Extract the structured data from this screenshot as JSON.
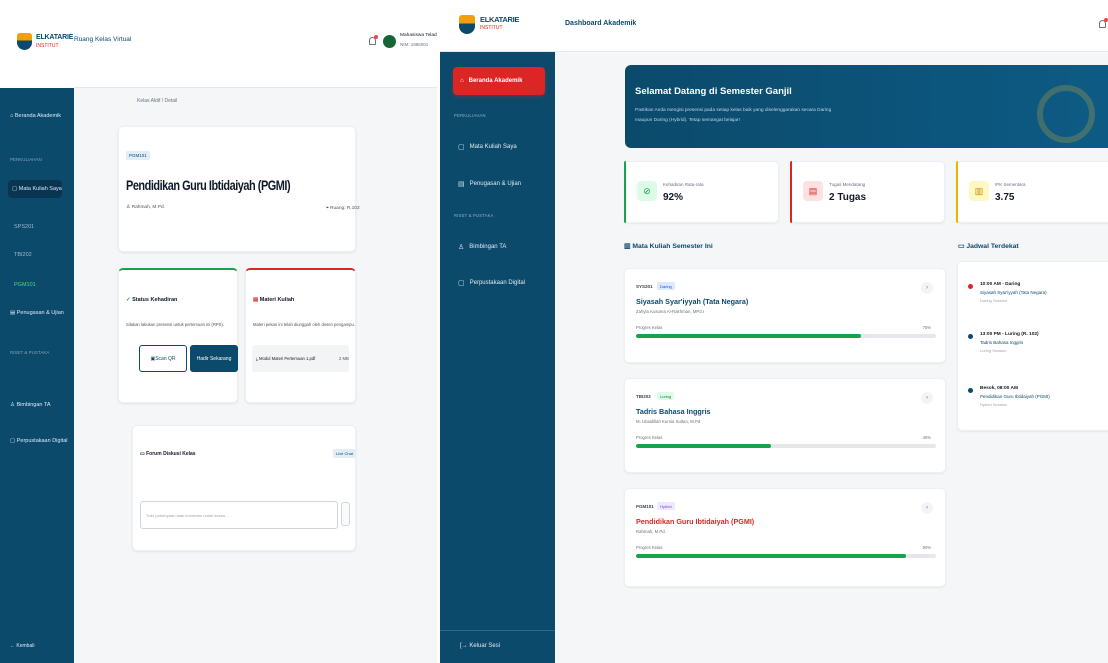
{
  "left": {
    "brand": {
      "name": "ELKATARIE",
      "sub": "INSTITUT"
    },
    "topbar_title": "Ruang Kelas Virtual",
    "user": {
      "name": "Mahasiswa Teladan",
      "id": "NIM: 1986001"
    },
    "nav": {
      "dashboard": "Beranda Akademik",
      "section1": "PERKULIAHAN",
      "courses": "Mata Kuliah Saya",
      "sub1": "SPS201",
      "sub2": "TBI202",
      "sub3": "PGM101",
      "tasks": "Penugasan & Ujian",
      "section2": "RISET & PUSTAKA",
      "thesis": "Bimbingan TA",
      "library": "Perpustakaan Digital",
      "back": "Kembali"
    },
    "breadcrumb": "Kelas Aktif / Detail",
    "course": {
      "code": "PGM101",
      "title": "Pendidikan Guru Ibtidaiyah (PGMI)",
      "lecturer": "Rahmah, M.Pd.",
      "room": "Ruang: R.102"
    },
    "attendance": {
      "title": "Status Kehadiran",
      "desc": "Silakan lakukan presensi untuk pertemuan ini (RPS).",
      "btn_scan": "Scan QR",
      "btn_present": "Hadir Sekarang"
    },
    "materials": {
      "title": "Materi Kuliah",
      "desc": "Materi pekan ini telah diunggah oleh dosen pengampu.",
      "file": "Modul Materi Pertemuan 1.pdf",
      "size": "2 MB"
    },
    "forum": {
      "title": "Forum Diskusi Kelas",
      "badge": "Live Chat",
      "placeholder": "Tulis pertanyaan atau komentar untuk dosen..."
    }
  },
  "right": {
    "brand": {
      "name": "ELKATARIE",
      "sub": "INSTITUT"
    },
    "topbar_title": "Dashboard Akademik",
    "nav": {
      "active": "Beranda Akademik",
      "section1": "PERKULIAHAN",
      "courses": "Mata Kuliah Saya",
      "tasks": "Penugasan & Ujian",
      "section2": "RISET & PUSTAKA",
      "thesis": "Bimbingan TA",
      "library": "Perpustakaan Digital",
      "logout": "Keluar Sesi"
    },
    "hero": {
      "title": "Selamat Datang di Semester Ganjil",
      "line1": "Pastikan Anda mengisi presensi pada setiap kelas baik yang diselenggarakan secara Daring",
      "line2": "maupun Daring (Hybrid). Tetap semangat belajar!"
    },
    "stats": [
      {
        "label": "Kehadiran Rata-rata",
        "value": "92%",
        "color": "#16a34a",
        "icon": "check-circle-icon"
      },
      {
        "label": "Tugas Mendatang",
        "value": "2 Tugas",
        "color": "#dc2626",
        "icon": "document-icon"
      },
      {
        "label": "IPK Sementara",
        "value": "3.75",
        "color": "#eab308",
        "icon": "book-icon"
      }
    ],
    "courses_heading": "Mata Kuliah Semester Ini",
    "schedule_heading": "Jadwal Terdekat",
    "courses": [
      {
        "code": "SYS201",
        "mode": "Daring",
        "title": "Siyasah Syar'iyyah (Tata Negara)",
        "lecturer": "Zahyla Kusuma Al-Rakhman, MPd.I",
        "progress_label": "Progres Kelas",
        "progress": 75,
        "progress_text": "75%"
      },
      {
        "code": "TBI202",
        "mode": "Luring",
        "title": "Tadris Bahasa Inggris",
        "lecturer": "M. Ubaidillah Kurnia Sultan, M.Pd",
        "progress_label": "Progres Kelas",
        "progress": 45,
        "progress_text": "45%"
      },
      {
        "code": "PGM101",
        "mode": "Hybrid",
        "title": "Pendidikan Guru Ibtidaiyah (PGMI)",
        "lecturer": "Rahmah, M.Pd.",
        "progress_label": "Progres Kelas",
        "progress": 90,
        "progress_text": "90%"
      }
    ],
    "schedule": [
      {
        "time": "10:00 AM - Daring",
        "course": "Siyasah Syar'iyyah (Tata Negara)",
        "session": "Daring Session",
        "color": "#dc2626"
      },
      {
        "time": "13:00 PM - Luring (R. 102)",
        "course": "Tadris Bahasa Inggris",
        "session": "Luring Session",
        "color": "#0b4a6b"
      },
      {
        "time": "Besok, 08:00 AM",
        "course": "Pendidikan Guru Ibtidaiyah (PGMI)",
        "session": "Hybrid Session",
        "color": "#0b4a6b"
      }
    ]
  }
}
